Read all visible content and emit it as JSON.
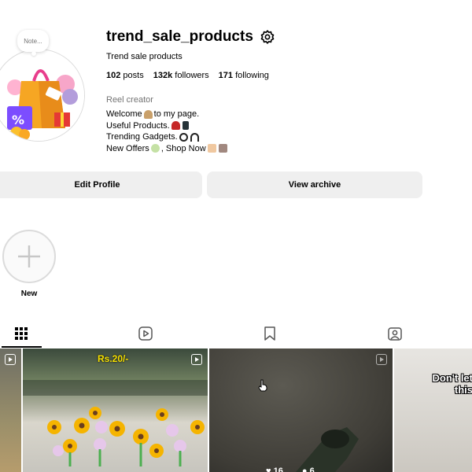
{
  "profile": {
    "note": "Note...",
    "username": "trend_sale_products",
    "fullname": "Trend sale products",
    "stats": {
      "posts_count": "102",
      "posts_label": "posts",
      "followers_count": "132k",
      "followers_label": "followers",
      "following_count": "171",
      "following_label": "following"
    },
    "category": "Reel creator",
    "bio": {
      "line1": "Welcome",
      "line1b": "to my page.",
      "line2": "Useful Products.",
      "line3": "Trending Gadgets.",
      "line4a": "New Offers",
      "line4b": " , Shop Now"
    }
  },
  "actions": {
    "edit_profile": "Edit Profile",
    "view_archive": "View archive"
  },
  "highlights": {
    "new_label": "New"
  },
  "tabs": [
    "posts-grid-icon",
    "reels-icon",
    "saved-icon",
    "tagged-icon"
  ],
  "grid": {
    "tile2_price": "Rs.20/-",
    "tile3_likes": "16",
    "tile3_comments": "6",
    "tile4_text_line1": "Don't let",
    "tile4_text_line2": "this"
  },
  "colors": {
    "button_bg": "#efefef",
    "muted_text": "#737373",
    "price_yellow": "#f6e000"
  }
}
